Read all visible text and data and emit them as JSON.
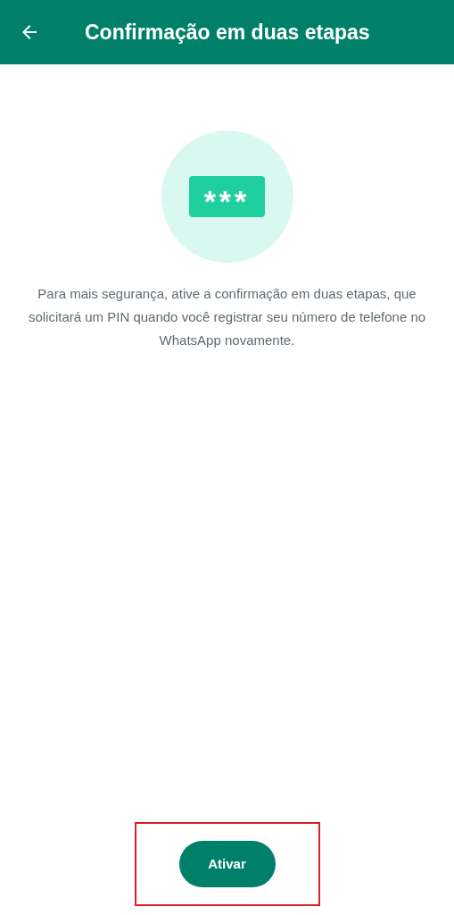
{
  "header": {
    "title": "Confirmação em duas etapas"
  },
  "illustration": {
    "pin_text": "***"
  },
  "description": "Para mais segurança, ative a confirmação em duas etapas, que solicitará um PIN quando você registrar seu número de telefone no WhatsApp novamente.",
  "button": {
    "label": "Ativar",
    "highlighted": true
  }
}
